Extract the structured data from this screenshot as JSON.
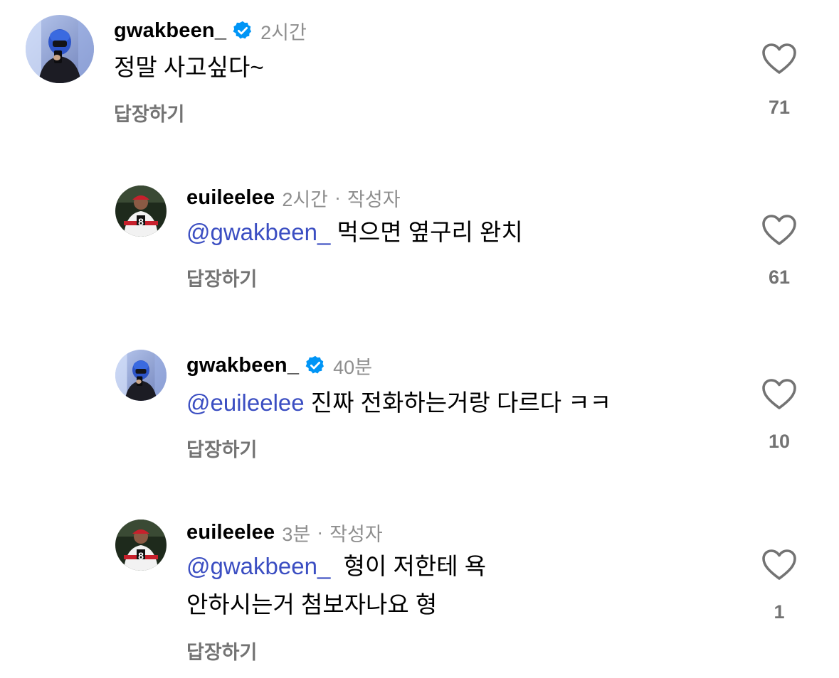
{
  "comments": [
    {
      "username": "gwakbeen_",
      "verified": true,
      "time": "2시간",
      "author_tag": "",
      "mention": "",
      "text": "정말 사고싶다~",
      "text_line2": "",
      "reply_label": "답장하기",
      "likes": "71",
      "avatar": "gwakbeen-avatar"
    },
    {
      "username": "euileelee",
      "verified": false,
      "time": "2시간",
      "author_tag": "작성자",
      "mention": "@gwakbeen_",
      "text": "먹으면 옆구리 완치",
      "text_line2": "",
      "reply_label": "답장하기",
      "likes": "61",
      "avatar": "euileelee-avatar"
    },
    {
      "username": "gwakbeen_",
      "verified": true,
      "time": "40분",
      "author_tag": "",
      "mention": "@euileelee",
      "text": "진짜 전화하는거랑 다르다 ㅋㅋ",
      "text_line2": "",
      "reply_label": "답장하기",
      "likes": "10",
      "avatar": "gwakbeen-avatar"
    },
    {
      "username": "euileelee",
      "verified": false,
      "time": "3분",
      "author_tag": "작성자",
      "mention": "@gwakbeen_",
      "text": " 형이 저한테 욕",
      "text_line2": "안하시는거 첨보자나요 형",
      "reply_label": "답장하기",
      "likes": "1",
      "avatar": "euileelee-avatar"
    }
  ],
  "icons": {
    "like": "heart-outline-icon",
    "verified": "verified-badge-icon"
  },
  "colors": {
    "mention": "#3b4ec2",
    "verified": "#0095f6",
    "meta": "#8e8e8e"
  }
}
